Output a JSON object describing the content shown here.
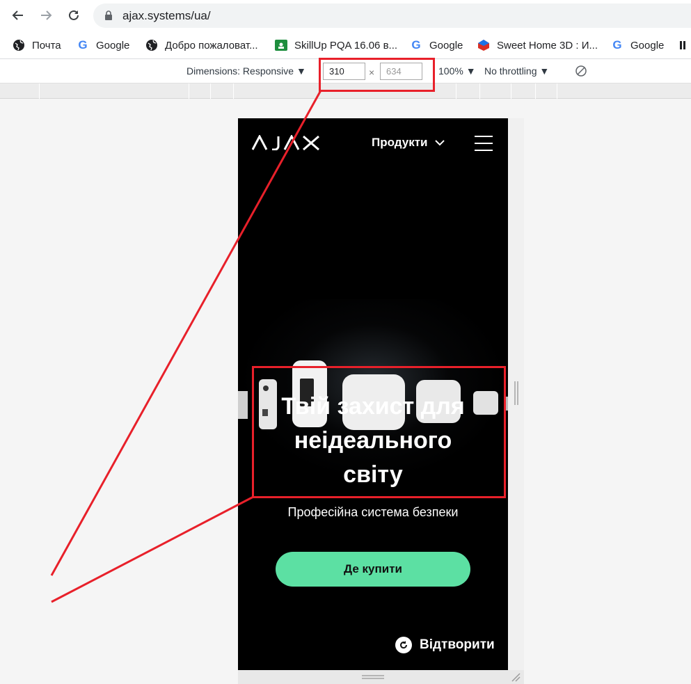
{
  "browser": {
    "url": "ajax.systems/ua/",
    "bookmarks": [
      {
        "label": "Почта",
        "icon": "globe-icon"
      },
      {
        "label": "Google",
        "icon": "google-icon"
      },
      {
        "label": "Добро пожаловат...",
        "icon": "globe-icon"
      },
      {
        "label": "SkillUp PQA 16.06 в...",
        "icon": "classroom-icon"
      },
      {
        "label": "Google",
        "icon": "google-icon"
      },
      {
        "label": "Sweet Home 3D : И...",
        "icon": "sweethome-icon"
      },
      {
        "label": "Google",
        "icon": "google-icon"
      }
    ]
  },
  "devtools": {
    "dimensions_label": "Dimensions: Responsive ▼",
    "width": "310",
    "times": "×",
    "height": "634",
    "zoom": "100% ▼",
    "throttling": "No throttling ▼"
  },
  "site": {
    "logo": "AJAX",
    "products": "Продукти",
    "hero_title_line1": "Твій захист для",
    "hero_title_line2": "неідеального",
    "hero_title_line3": "світу",
    "hero_subtitle": "Професійна система безпеки",
    "buy_button": "Де купити",
    "play_label": "Відтворити"
  },
  "colors": {
    "accent_green": "#5ce0a3",
    "annotation_red": "#e8202a"
  }
}
